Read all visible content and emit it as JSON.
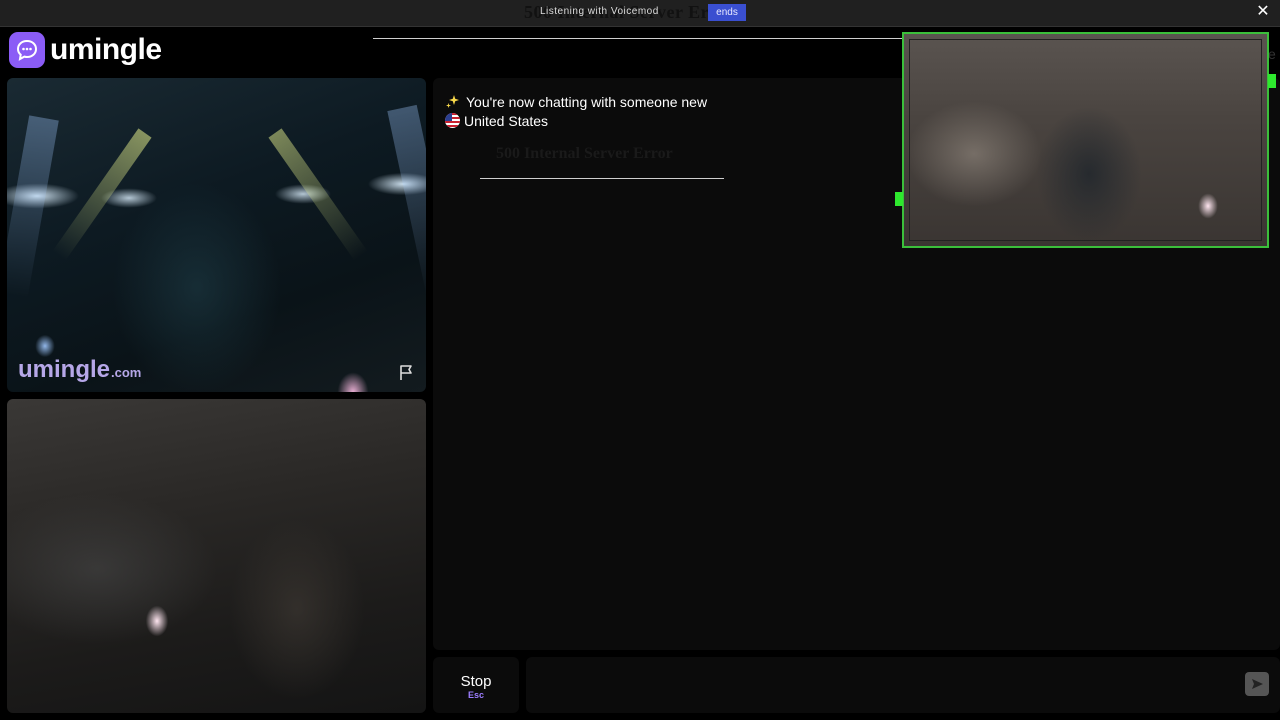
{
  "topbar": {
    "ghost_title": "500 Internal Server Error",
    "caption": "Listening with Voicemod",
    "caption_highlight": "ends"
  },
  "header": {
    "logo_text": "umingle"
  },
  "stranger_video": {
    "watermark_main": "umingle",
    "watermark_suffix": ".com",
    "report_icon": "flag-icon"
  },
  "chat": {
    "status_message": "You're now chatting with someone new",
    "country": "United States",
    "ghost_error": "500 Internal Server Error"
  },
  "controls": {
    "stop_label": "Stop",
    "stop_shortcut": "Esc",
    "message_placeholder": "",
    "send_icon": "send-icon"
  },
  "colors": {
    "brand": "#8b5cf6",
    "overlay_border": "#3bbf3b",
    "accent_text": "#9c7dff"
  }
}
